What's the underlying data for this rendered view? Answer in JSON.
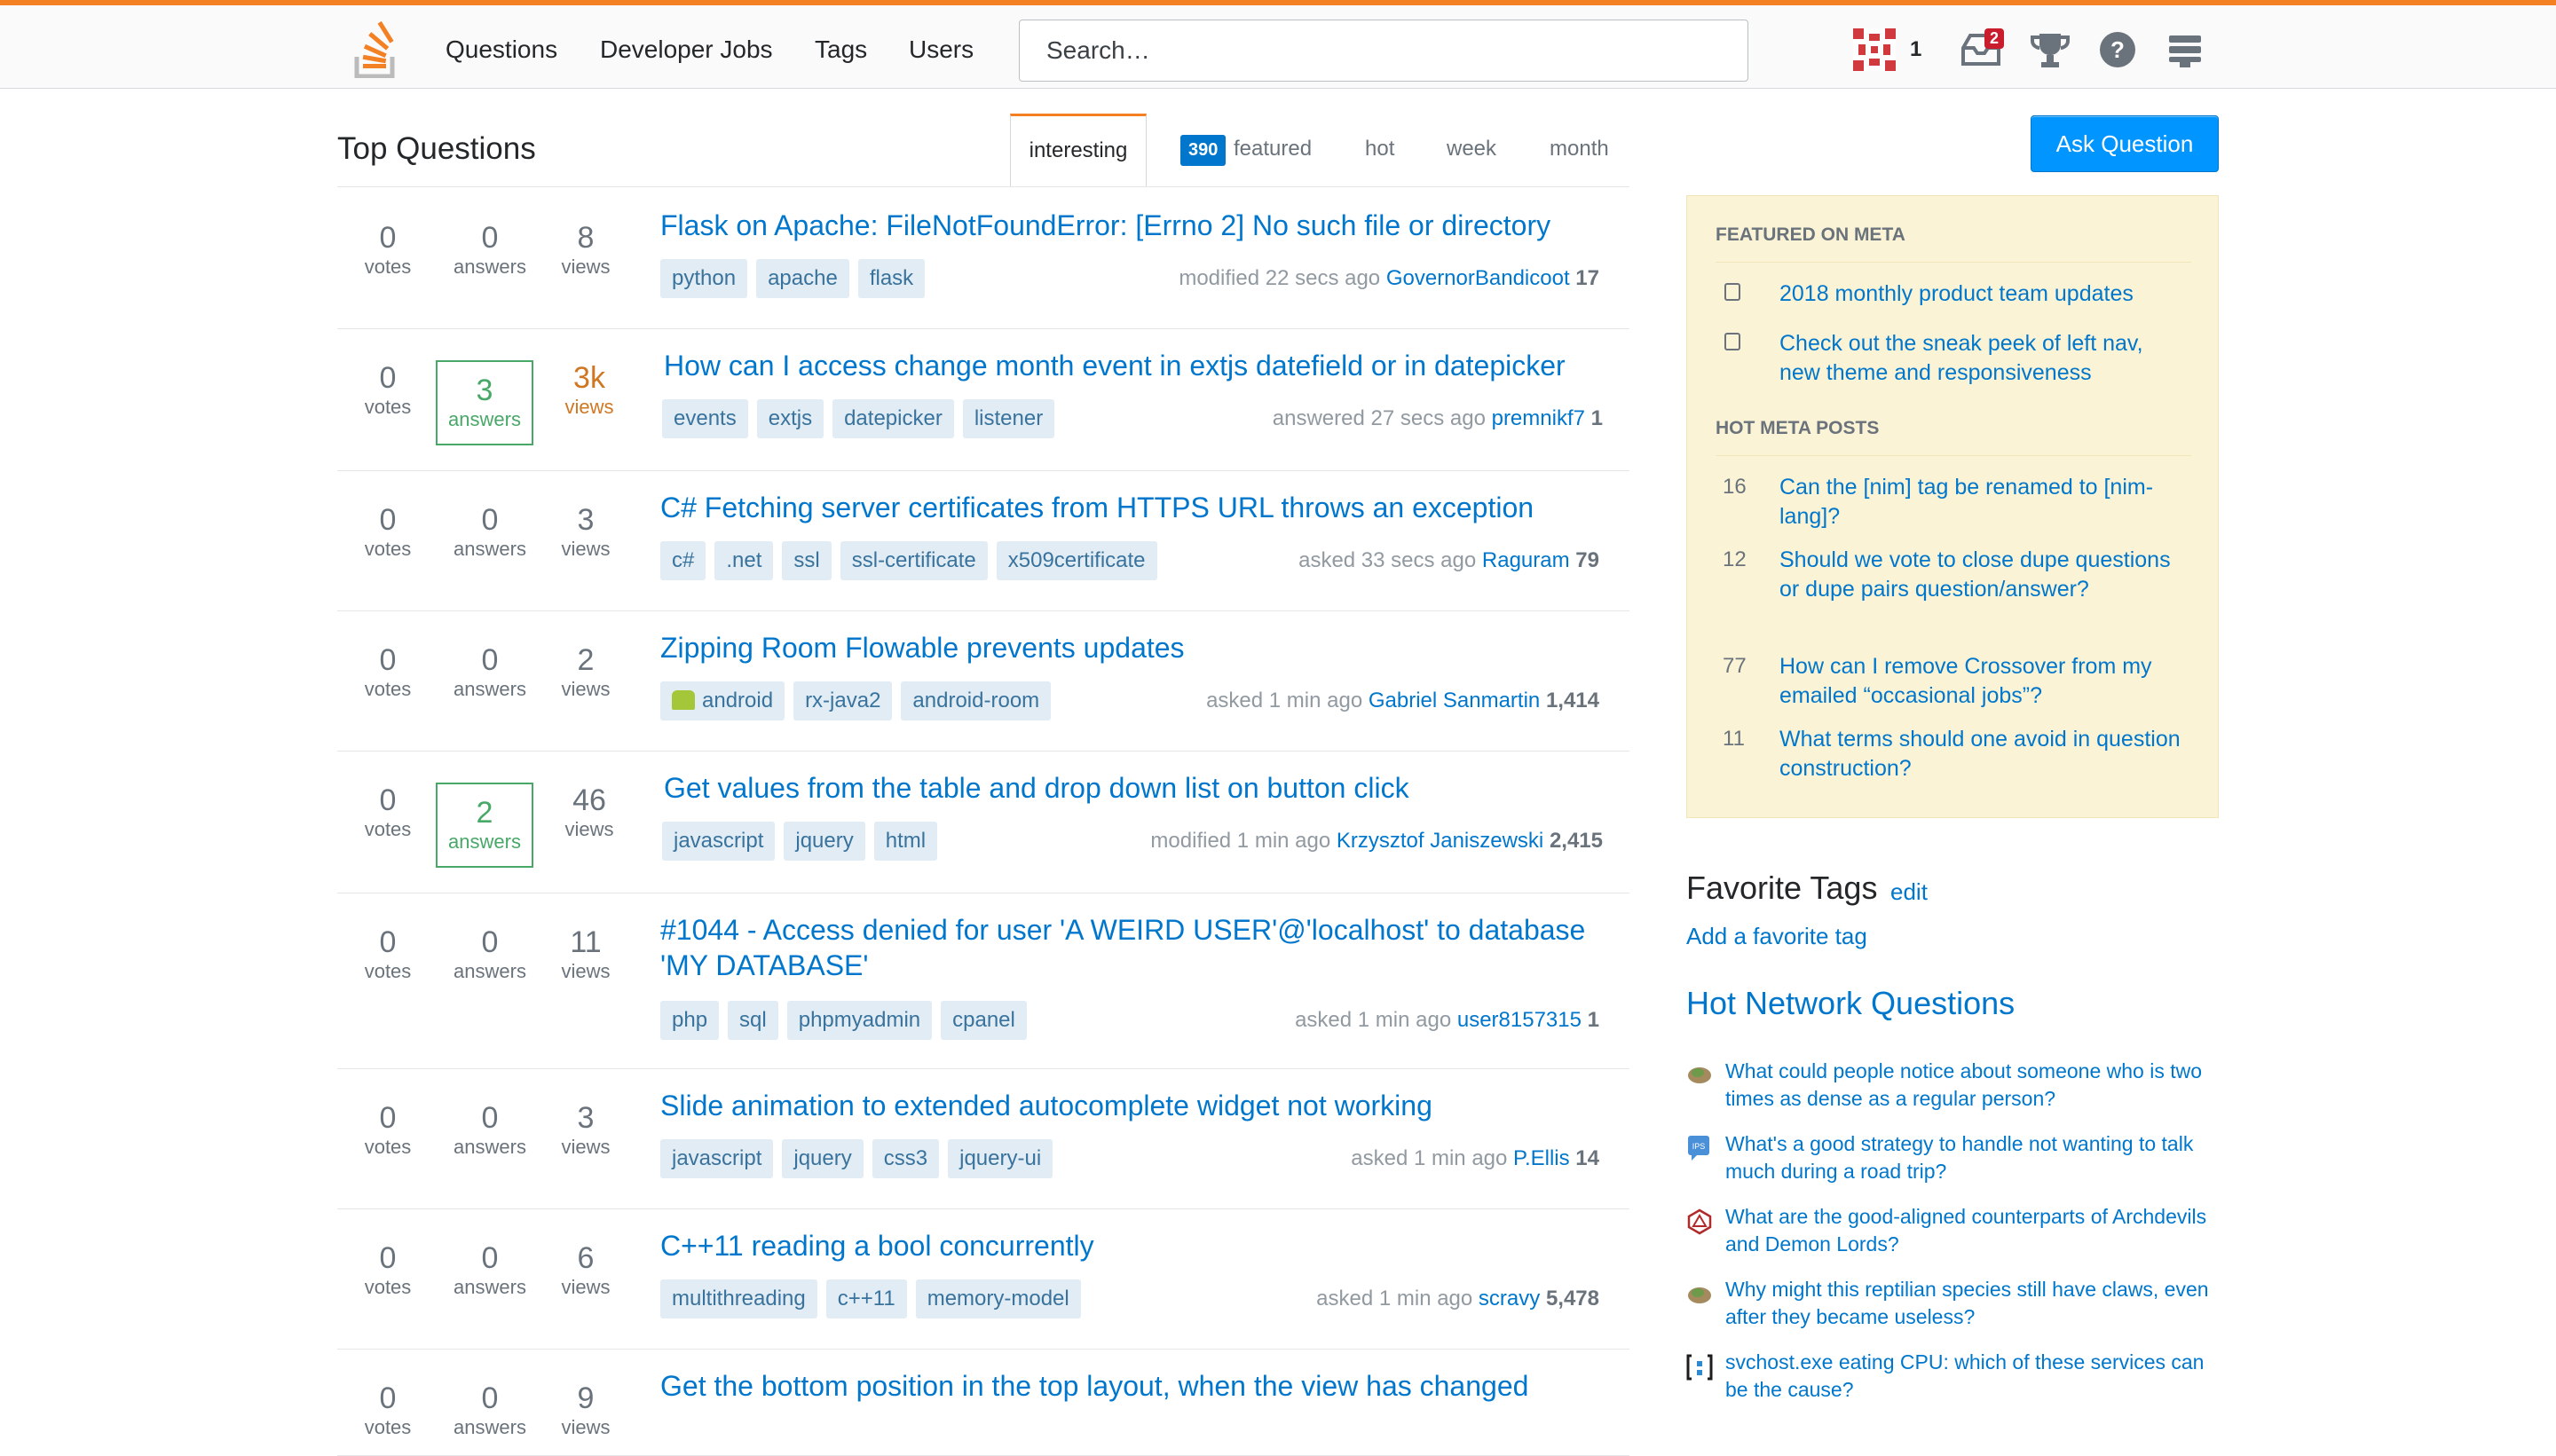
{
  "nav": {
    "items": [
      "Questions",
      "Developer Jobs",
      "Tags",
      "Users"
    ],
    "search_placeholder": "Search…",
    "reputation": "1",
    "inbox_count": "2"
  },
  "main": {
    "title": "Top Questions",
    "tabs": [
      "interesting",
      "featured",
      "hot",
      "week",
      "month"
    ],
    "featured_count": "390",
    "active_tab": "interesting",
    "ask_button": "Ask Question"
  },
  "questions": [
    {
      "votes": "0",
      "votes_label": "votes",
      "answers": "0",
      "answers_label": "answers",
      "views": "8",
      "views_label": "views",
      "answered": false,
      "hot": false,
      "title": "Flask on Apache: FileNotFoundError: [Errno 2] No such file or directory",
      "tags": [
        "python",
        "apache",
        "flask"
      ],
      "action": "modified 22 secs ago",
      "user": "GovernorBandicoot",
      "rep": "17"
    },
    {
      "votes": "0",
      "votes_label": "votes",
      "answers": "3",
      "answers_label": "answers",
      "views": "3k",
      "views_label": "views",
      "answered": true,
      "hot": true,
      "title": "How can I access change month event in extjs datefield or in datepicker",
      "tags": [
        "events",
        "extjs",
        "datepicker",
        "listener"
      ],
      "action": "answered 27 secs ago",
      "user": "premnikf7",
      "rep": "1"
    },
    {
      "votes": "0",
      "votes_label": "votes",
      "answers": "0",
      "answers_label": "answers",
      "views": "3",
      "views_label": "views",
      "answered": false,
      "hot": false,
      "title": "C# Fetching server certificates from HTTPS URL throws an exception",
      "tags": [
        "c#",
        ".net",
        "ssl",
        "ssl-certificate",
        "x509certificate"
      ],
      "action": "asked 33 secs ago",
      "user": "Raguram",
      "rep": "79"
    },
    {
      "votes": "0",
      "votes_label": "votes",
      "answers": "0",
      "answers_label": "answers",
      "views": "2",
      "views_label": "views",
      "answered": false,
      "hot": false,
      "title": "Zipping Room Flowable prevents updates",
      "tags": [
        "android",
        "rx-java2",
        "android-room"
      ],
      "action": "asked 1 min ago",
      "user": "Gabriel Sanmartin",
      "rep": "1,414"
    },
    {
      "votes": "0",
      "votes_label": "votes",
      "answers": "2",
      "answers_label": "answers",
      "views": "46",
      "views_label": "views",
      "answered": true,
      "hot": false,
      "title": "Get values from the table and drop down list on button click",
      "tags": [
        "javascript",
        "jquery",
        "html"
      ],
      "action": "modified 1 min ago",
      "user": "Krzysztof Janiszewski",
      "rep": "2,415"
    },
    {
      "votes": "0",
      "votes_label": "votes",
      "answers": "0",
      "answers_label": "answers",
      "views": "11",
      "views_label": "views",
      "answered": false,
      "hot": false,
      "title": "#1044 - Access denied for user 'A WEIRD USER'@'localhost' to database 'MY DATABASE'",
      "tags": [
        "php",
        "sql",
        "phpmyadmin",
        "cpanel"
      ],
      "action": "asked 1 min ago",
      "user": "user8157315",
      "rep": "1"
    },
    {
      "votes": "0",
      "votes_label": "votes",
      "answers": "0",
      "answers_label": "answers",
      "views": "3",
      "views_label": "views",
      "answered": false,
      "hot": false,
      "title": "Slide animation to extended autocomplete widget not working",
      "tags": [
        "javascript",
        "jquery",
        "css3",
        "jquery-ui"
      ],
      "action": "asked 1 min ago",
      "user": "P.Ellis",
      "rep": "14"
    },
    {
      "votes": "0",
      "votes_label": "votes",
      "answers": "0",
      "answers_label": "answers",
      "views": "6",
      "views_label": "views",
      "answered": false,
      "hot": false,
      "title": "C++11 reading a bool concurrently",
      "tags": [
        "multithreading",
        "c++11",
        "memory-model"
      ],
      "action": "asked 1 min ago",
      "user": "scravy",
      "rep": "5,478"
    },
    {
      "votes": "0",
      "votes_label": "votes",
      "answers": "0",
      "answers_label": "answers",
      "views": "9",
      "views_label": "views",
      "answered": false,
      "hot": false,
      "title": "Get the bottom position in the top layout, when the view has changed",
      "tags": [],
      "action": "",
      "user": "",
      "rep": ""
    }
  ],
  "sidebar": {
    "featured_heading": "FEATURED ON META",
    "featured": [
      "2018 monthly product team updates",
      "Check out the sneak peek of left nav, new theme and responsiveness"
    ],
    "hot_meta_heading": "HOT META POSTS",
    "hot_meta": [
      {
        "count": "16",
        "title": "Can the [nim] tag be renamed to [nim-lang]?"
      },
      {
        "count": "12",
        "title": "Should we vote to close dupe questions or dupe pairs question/answer?"
      },
      {
        "count": "77",
        "title": "How can I remove Crossover from my emailed “occasional jobs”?"
      },
      {
        "count": "11",
        "title": "What terms should one avoid in question construction?"
      }
    ],
    "fav_tags_title": "Favorite Tags",
    "fav_tags_edit": "edit",
    "fav_tags_add": "Add a favorite tag",
    "hnq_title": "Hot Network Questions",
    "hnq": [
      {
        "icon": "worldbuilding-icon",
        "title": "What could people notice about someone who is two times as dense as a regular person?"
      },
      {
        "icon": "interpersonal-icon",
        "title": "What's a good strategy to handle not wanting to talk much during a road trip?"
      },
      {
        "icon": "rpg-icon",
        "title": "What are the good-aligned counterparts of Archdevils and Demon Lords?"
      },
      {
        "icon": "worldbuilding-icon",
        "title": "Why might this reptilian species still have claws, even after they became useless?"
      },
      {
        "icon": "superuser-icon",
        "title": "svchost.exe eating CPU: which of these services can be the cause?"
      }
    ]
  },
  "colors": {
    "accent": "#f48024",
    "link": "#0077cc",
    "answered": "#48a868",
    "hot": "#cf7721",
    "tag_bg": "#e1ecf4",
    "tag_text": "#39739d"
  }
}
